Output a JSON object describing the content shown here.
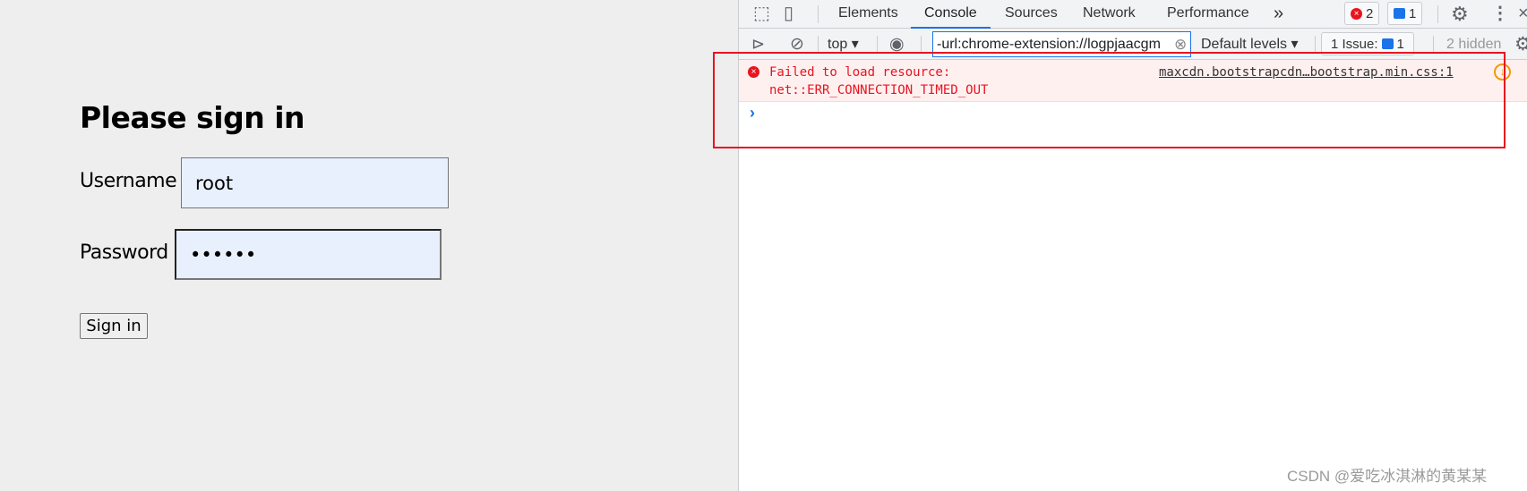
{
  "login": {
    "title": "Please sign in",
    "username_label": "Username",
    "username_value": "root",
    "password_label": "Password",
    "password_value": "••••••",
    "submit_label": "Sign in"
  },
  "devtools": {
    "tabs": [
      {
        "label": "Elements"
      },
      {
        "label": "Console",
        "active": true
      },
      {
        "label": "Sources"
      },
      {
        "label": "Network"
      },
      {
        "label": "Performance"
      }
    ],
    "more_tabs": "»",
    "error_count": "2",
    "message_count": "1",
    "toolbar": {
      "context": "top",
      "filter_value": "-url:chrome-extension://logpjaacgm",
      "levels": "Default levels",
      "issues_label": "1 Issue:",
      "issues_count": "1",
      "hidden": "2 hidden"
    },
    "console": {
      "messages": [
        {
          "level": "error",
          "text_line1": "Failed to load resource:",
          "text_line2": "net::ERR_CONNECTION_TIMED_OUT",
          "source": "maxcdn.bootstrapcdn…bootstrap.min.css:1"
        }
      ],
      "prompt": "›"
    },
    "colors": {
      "accent": "#1a73e8",
      "error": "#e8141f",
      "error_bg": "#fff0f0"
    }
  },
  "watermark": "CSDN @爱吃冰淇淋的黄某某"
}
